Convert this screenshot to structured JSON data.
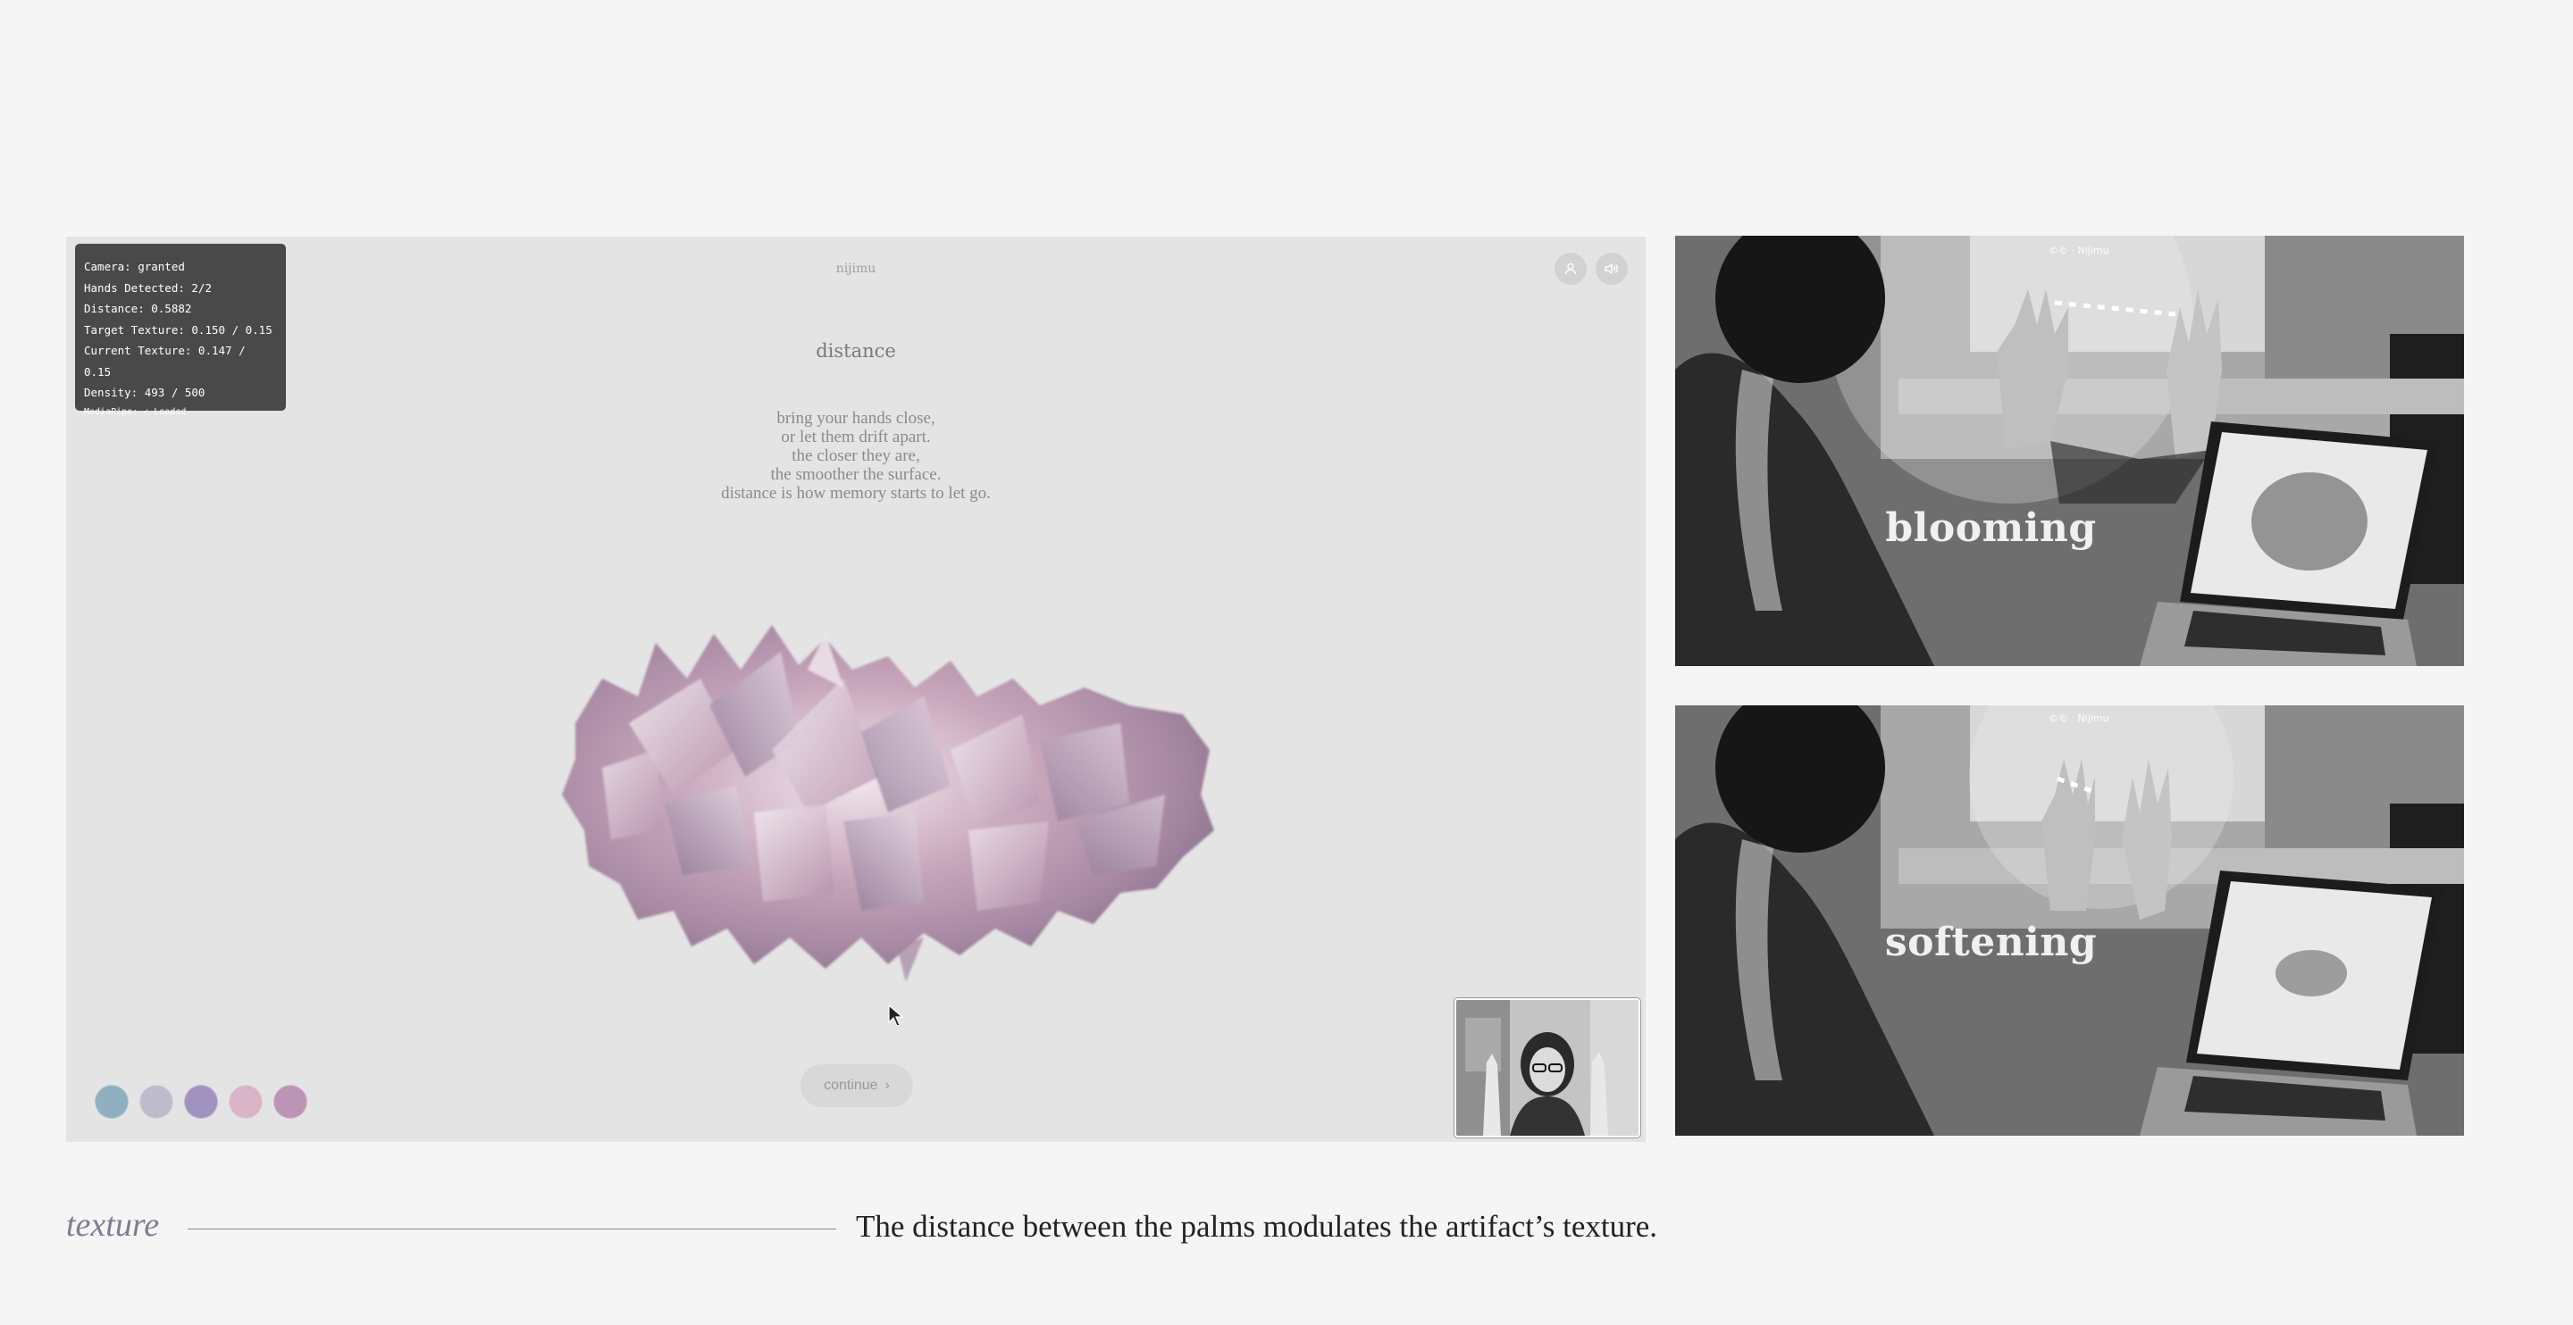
{
  "app": {
    "brand": "nijimu",
    "heading": "distance",
    "poem": [
      "bring your hands close,",
      "or let them drift apart.",
      "the closer they are,",
      "the smoother the surface.",
      "distance is how memory starts to let go."
    ],
    "continue_label": "continue",
    "continue_arrow": "›",
    "icons": [
      "user-icon",
      "speaker-icon"
    ],
    "swatches": [
      "#8fb0c0",
      "#bcbccc",
      "#a193bf",
      "#d9b3c6",
      "#bb94b8"
    ]
  },
  "debug": {
    "camera": "Camera: granted",
    "hands": "Hands Detected: 2/2",
    "distance": "Distance: 0.5882",
    "target_texture": "Target Texture: 0.150 / 0.15",
    "current_texture": "Current Texture: 0.147 / 0.15",
    "density": "Density: 493 / 500",
    "mediapipe": "MediaPipe: ✓ Loaded"
  },
  "photos": [
    {
      "label": "blooming",
      "tag": "©© · Nijimu"
    },
    {
      "label": "softening",
      "tag": "©© · Nijimu"
    }
  ],
  "caption": {
    "term": "texture",
    "text": "The distance between the palms modulates the artifact’s texture."
  }
}
